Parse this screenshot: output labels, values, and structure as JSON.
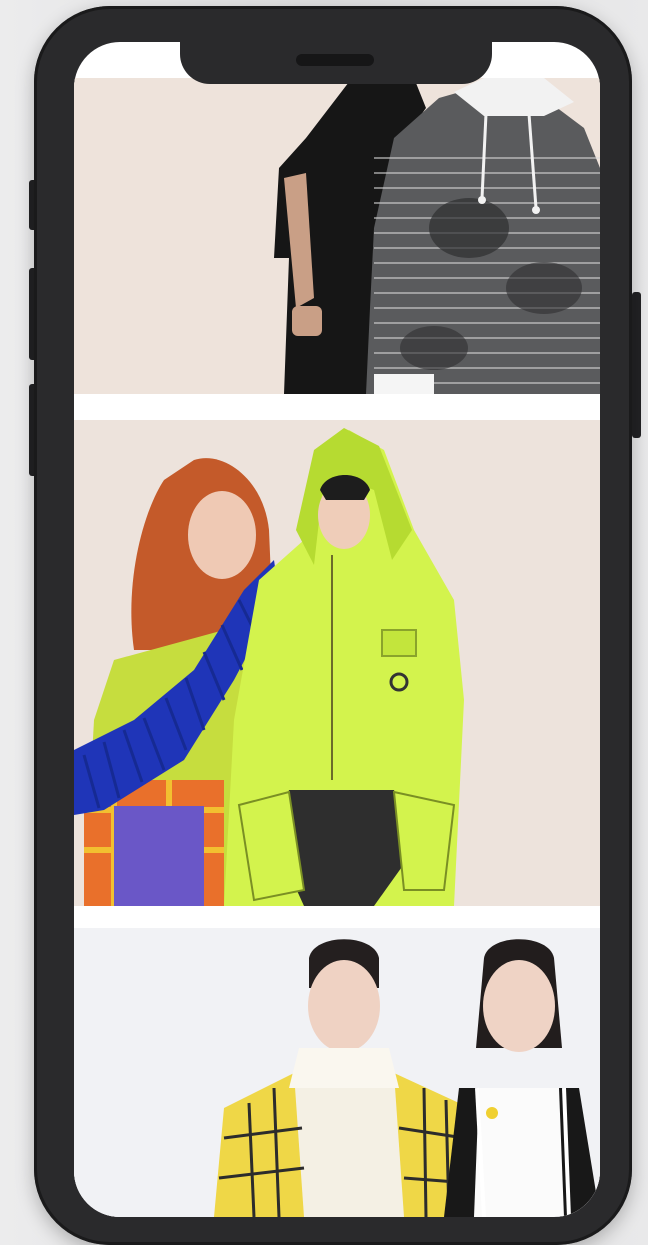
{
  "device": {
    "frame_color": "#2a2a2c",
    "screen_color": "#ffffff"
  },
  "gallery": {
    "items": [
      {
        "icon": "fashion-photo-shirt-dress-and-tie-dye-hoodie",
        "background": "#eee3db"
      },
      {
        "icon": "fashion-photo-knit-scarf-and-neon-hooded-jacket",
        "background": "#ede3dc"
      },
      {
        "icon": "fashion-photo-plaid-jacket-and-white-tops",
        "background": "#f1f2f5"
      }
    ]
  }
}
